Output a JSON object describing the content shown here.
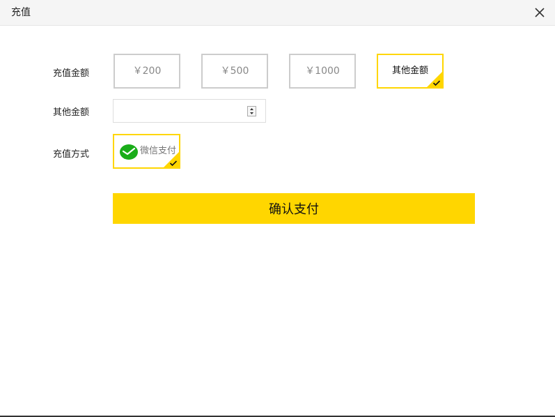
{
  "window": {
    "title": "充值",
    "close_icon": "close-icon"
  },
  "form": {
    "amount_label": "充值金额",
    "amount_options": [
      {
        "label": "￥200",
        "selected": false
      },
      {
        "label": "￥500",
        "selected": false
      },
      {
        "label": "￥1000",
        "selected": false
      },
      {
        "label": "其他金额",
        "selected": true
      }
    ],
    "other_amount_label": "其他金额",
    "other_amount_value": "",
    "method_label": "充值方式",
    "methods": [
      {
        "label": "微信支付",
        "icon": "wechat-pay-icon",
        "selected": true
      }
    ],
    "confirm_label": "确认支付"
  },
  "colors": {
    "accent": "#ffd600",
    "wechat_green": "#1aad19",
    "option_border": "#cccccc"
  }
}
